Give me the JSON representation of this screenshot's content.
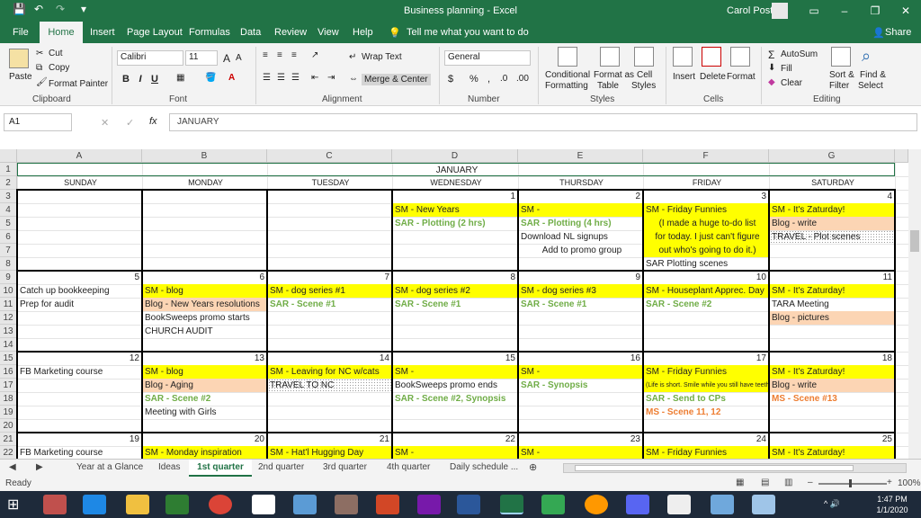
{
  "window": {
    "title": "Business planning  -  Excel",
    "user": "Carol Post",
    "buttons": [
      "▭",
      "–",
      "❐",
      "✕"
    ]
  },
  "quick_access": [
    "💾",
    "↶",
    "↷",
    "▾"
  ],
  "ribbon_tabs": [
    "File",
    "Home",
    "Insert",
    "Page Layout",
    "Formulas",
    "Data",
    "Review",
    "View",
    "Help"
  ],
  "tell_me": "Tell me what you want to do",
  "share": "Share",
  "clipboard": {
    "paste": "Paste",
    "cut": "Cut",
    "copy": "Copy",
    "format_painter": "Format Painter",
    "label": "Clipboard"
  },
  "font": {
    "name": "Calibri",
    "size": "11",
    "label": "Font",
    "bold": "B",
    "italic": "I",
    "underline": "U"
  },
  "alignment": {
    "wrap": "Wrap Text",
    "merge": "Merge & Center",
    "label": "Alignment"
  },
  "number": {
    "format": "General",
    "label": "Number",
    "currency": "$",
    "percent": "%",
    "comma": ","
  },
  "styles": {
    "conditional": "Conditional",
    "formatting": "Formatting",
    "format_as": "Format as",
    "table": "Table",
    "cell": "Cell",
    "cell_styles": "Styles",
    "label": "Styles"
  },
  "cells": {
    "insert": "Insert",
    "delete": "Delete",
    "format": "Format",
    "label": "Cells"
  },
  "editing": {
    "autosum": "AutoSum",
    "fill": "Fill",
    "clear": "Clear",
    "sort": "Sort &",
    "filter": "Filter",
    "find": "Find &",
    "select": "Select",
    "label": "Editing"
  },
  "formula_bar": {
    "name_box": "A1",
    "fx": "fx",
    "content": "JANUARY",
    "cancel": "✕",
    "enter": "✓"
  },
  "columns": [
    "A",
    "B",
    "C",
    "D",
    "E",
    "F",
    "G"
  ],
  "rows": [
    "1",
    "2",
    "3",
    "4",
    "5",
    "6",
    "7",
    "8",
    "9",
    "10",
    "11",
    "12",
    "13",
    "14",
    "15",
    "16",
    "17",
    "18",
    "19",
    "20",
    "21",
    "22"
  ],
  "sheet": {
    "title": "JANUARY",
    "days": [
      "SUNDAY",
      "MONDAY",
      "TUESDAY",
      "WEDNESDAY",
      "THURSDAY",
      "FRIDAY",
      "SATURDAY"
    ],
    "week1": {
      "nums": [
        "",
        "",
        "",
        "1",
        "2",
        "3",
        "4"
      ],
      "D": [
        "SM - New Years",
        "SAR - Plotting (2 hrs)"
      ],
      "E": [
        "SM -",
        "SAR - Plotting (4 hrs)",
        "Download NL signups",
        "Add to promo group"
      ],
      "F": [
        "SM - Friday Funnies",
        "(I made a huge to-do list",
        "for today. I just can't figure",
        "out who's going to do it.)",
        "SAR Plotting scenes"
      ],
      "G": [
        "SM - It's Zaturday!",
        "Blog - write",
        "TRAVEL - Plot scenes"
      ]
    },
    "week2": {
      "nums": [
        "5",
        "6",
        "7",
        "8",
        "9",
        "10",
        "11"
      ],
      "A": [
        "Catch up bookkeeping",
        "Prep for audit"
      ],
      "B": [
        "SM - blog",
        "Blog - New Years resolutions",
        "BookSweeps promo starts",
        "CHURCH AUDIT"
      ],
      "C": [
        "SM - dog series #1",
        "SAR - Scene #1"
      ],
      "D": [
        "SM - dog series #2",
        "SAR - Scene #1"
      ],
      "E": [
        "SM - dog series #3",
        "SAR - Scene #1"
      ],
      "F": [
        "SM - Houseplant Apprec. Day",
        "SAR - Scene #2"
      ],
      "G": [
        "SM - It's Zaturday!",
        "TARA Meeting",
        "Blog - pictures"
      ]
    },
    "week3": {
      "nums": [
        "12",
        "13",
        "14",
        "15",
        "16",
        "17",
        "18"
      ],
      "A": [
        "FB Marketing course"
      ],
      "B": [
        "SM - blog",
        "Blog - Aging",
        "SAR - Scene #2",
        "Meeting with Girls"
      ],
      "C": [
        "SM - Leaving for NC w/cats",
        "TRAVEL TO NC"
      ],
      "D": [
        "SM -",
        "BookSweeps promo ends",
        "SAR - Scene #2, Synopsis"
      ],
      "E": [
        "SM -",
        "SAR - Synopsis"
      ],
      "F": [
        "SM - Friday Funnies",
        "(Life is short. Smile while you still have teeth.)",
        "SAR - Send to CPs",
        "MS - Scene 11, 12"
      ],
      "G": [
        "SM - It's Zaturday!",
        "Blog - write",
        "MS - Scene #13"
      ]
    },
    "week4": {
      "nums": [
        "19",
        "20",
        "21",
        "22",
        "23",
        "24",
        "25"
      ],
      "A": [
        "FB Marketing course"
      ],
      "B": [
        "SM - Monday inspiration"
      ],
      "C": [
        "SM - Hat'l Hugging Day"
      ],
      "D": [
        "SM -"
      ],
      "E": [
        "SM -"
      ],
      "F": [
        "SM - Friday Funnies"
      ],
      "G": [
        "SM - It's Zaturday!"
      ]
    }
  },
  "sheet_tabs": [
    "Year at a Glance",
    "Ideas",
    "1st quarter",
    "2nd quarter",
    "3rd quarter",
    "4th quarter",
    "Daily schedule ..."
  ],
  "active_sheet": "1st quarter",
  "status": {
    "ready": "Ready",
    "zoom": "100%"
  },
  "clock": {
    "time": "1:47 PM",
    "date": "1/1/2020"
  },
  "colors": {
    "accent": "#217346",
    "highlight_yellow": "#ffff00",
    "highlight_orange": "#fcd5b4",
    "green_text": "#70ad47",
    "orange_text": "#ed7d31"
  }
}
